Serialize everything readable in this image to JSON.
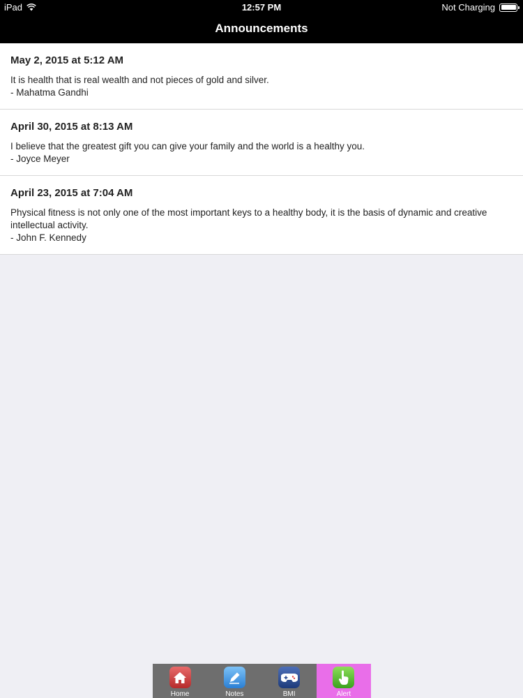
{
  "status_bar": {
    "device": "iPad",
    "time": "12:57 PM",
    "battery_status": "Not Charging"
  },
  "nav": {
    "title": "Announcements"
  },
  "announcements": [
    {
      "date": "May 2, 2015 at 5:12 AM",
      "quote": "It is health that is real wealth and not pieces of gold and silver.",
      "author": "- Mahatma Gandhi"
    },
    {
      "date": "April 30, 2015 at 8:13 AM",
      "quote": "I believe that the greatest gift you can give your family and the world is a healthy you.",
      "author": "- Joyce Meyer"
    },
    {
      "date": "April 23, 2015 at 7:04 AM",
      "quote": "Physical fitness is not only one of the most important keys to a healthy body, it is the basis of dynamic and creative intellectual activity.",
      "author": "- John F. Kennedy"
    }
  ],
  "tabbar": {
    "selected_color": "#e96ee9",
    "tabs": [
      {
        "label": "Home",
        "icon": "home-icon"
      },
      {
        "label": "Notes",
        "icon": "pencil-icon"
      },
      {
        "label": "BMI",
        "icon": "gamepad-icon"
      },
      {
        "label": "Alert",
        "icon": "hand-pointer-icon"
      }
    ]
  }
}
